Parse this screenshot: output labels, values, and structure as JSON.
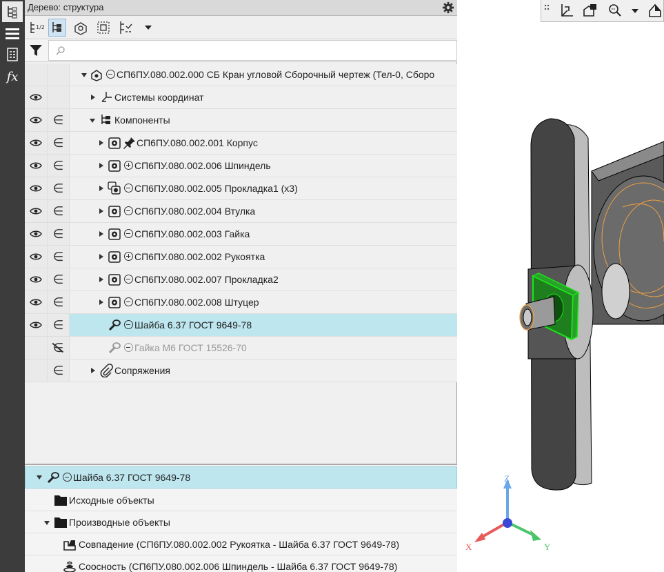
{
  "panel": {
    "title": "Дерево: структура",
    "search_placeholder": ""
  },
  "tree": {
    "root": "СП6ПУ.080.002.000 СБ Кран угловой Сборочный чертеж (Тел-0, Сборо",
    "coord_systems": "Системы координат",
    "components": "Компоненты",
    "items": [
      {
        "label": "СП6ПУ.080.002.001 Корпус"
      },
      {
        "label": "СП6ПУ.080.002.006 Шпиндель"
      },
      {
        "label": "СП6ПУ.080.002.005 Прокладка1 (x3)"
      },
      {
        "label": "СП6ПУ.080.002.004 Втулка"
      },
      {
        "label": "СП6ПУ.080.002.003 Гайка"
      },
      {
        "label": "СП6ПУ.080.002.002 Рукоятка"
      },
      {
        "label": "СП6ПУ.080.002.007 Прокладка2"
      },
      {
        "label": "СП6ПУ.080.002.008 Штуцер"
      },
      {
        "label": "Шайба 6.37 ГОСТ 9649-78"
      },
      {
        "label": "Гайка М6 ГОСТ 15526-70"
      }
    ],
    "mates": "Сопряжения"
  },
  "props": {
    "selected": "Шайба 6.37 ГОСТ 9649-78",
    "source_objects": "Исходные объекты",
    "derived_objects": "Производные объекты",
    "derived": [
      "Совпадение (СП6ПУ.080.002.002 Рукоятка  -  Шайба 6.37 ГОСТ 9649-78)",
      "Соосность (СП6ПУ.080.002.006 Шпиндель  -  Шайба 6.37 ГОСТ 9649-78)"
    ]
  },
  "axes": {
    "x": "X",
    "y": "Y",
    "z": "Z"
  },
  "colors": {
    "selection": "#bde6ef",
    "highlight": "#19e619",
    "sketch": "#f0a040"
  },
  "icons": {
    "sidebar": [
      "tree-icon",
      "menu-icon",
      "properties-icon",
      "formula-icon"
    ],
    "toolbar": [
      "structure-view-icon",
      "build-tree-icon",
      "components-icon",
      "select-icon",
      "display-options-icon",
      "dropdown-icon"
    ],
    "view": [
      "grip-icon",
      "orientation-icon",
      "view-camera-icon",
      "zoom-icon",
      "dropdown-icon",
      "view-tool-icon"
    ]
  }
}
